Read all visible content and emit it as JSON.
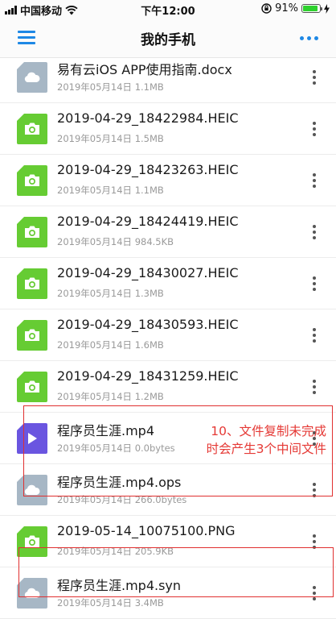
{
  "status_bar": {
    "carrier": "中国移动",
    "time": "下午12:00",
    "battery": "91%",
    "battery_level": 0.91
  },
  "nav": {
    "title": "我的手机",
    "menu_icon": "hamburger-menu-icon",
    "more_icon": "more-horizontal-icon"
  },
  "files": [
    {
      "name": "易有云iOS APP使用指南.docx",
      "meta": "2019年05月14日  1.1MB",
      "icon": "cloud"
    },
    {
      "name": "2019-04-29_18422984.HEIC",
      "meta": "2019年05月14日  1.5MB",
      "icon": "image"
    },
    {
      "name": "2019-04-29_18423263.HEIC",
      "meta": "2019年05月14日  1.1MB",
      "icon": "image"
    },
    {
      "name": "2019-04-29_18424419.HEIC",
      "meta": "2019年05月14日  984.5KB",
      "icon": "image"
    },
    {
      "name": "2019-04-29_18430027.HEIC",
      "meta": "2019年05月14日  1.3MB",
      "icon": "image"
    },
    {
      "name": "2019-04-29_18430593.HEIC",
      "meta": "2019年05月14日  1.6MB",
      "icon": "image"
    },
    {
      "name": "2019-04-29_18431259.HEIC",
      "meta": "2019年05月14日  1.2MB",
      "icon": "image"
    },
    {
      "name": "程序员生涯.mp4",
      "meta": "2019年05月14日  0.0bytes",
      "icon": "video"
    },
    {
      "name": "程序员生涯.mp4.ops",
      "meta": "2019年05月14日  266.0bytes",
      "icon": "cloud"
    },
    {
      "name": "2019-05-14_10075100.PNG",
      "meta": "2019年05月14日  205.9KB",
      "icon": "image"
    },
    {
      "name": "程序员生涯.mp4.syn",
      "meta": "2019年05月14日  3.4MB",
      "icon": "cloud"
    }
  ],
  "annotation": {
    "line1": "10、文件复制未完成",
    "line2": "时会产生3个中间文件",
    "color": "#e53935"
  }
}
